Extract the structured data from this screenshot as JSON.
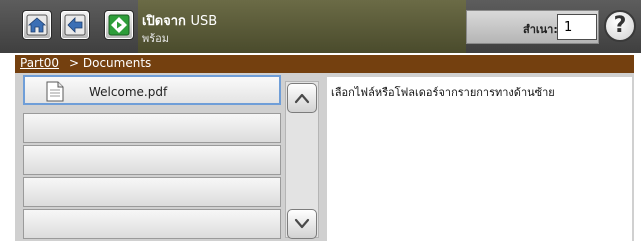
{
  "header": {
    "title": "เปิดจาก",
    "title_suffix": "USB",
    "status": "พร้อม",
    "copies_label": "สำเนา:",
    "copies_value": "1",
    "help_label": "?"
  },
  "breadcrumb": {
    "parent": "Part00",
    "current": "> Documents"
  },
  "files": [
    {
      "name": "Welcome.pdf",
      "icon": "document-icon",
      "selected": true
    },
    {
      "name": ""
    },
    {
      "name": ""
    },
    {
      "name": ""
    },
    {
      "name": ""
    }
  ],
  "info": {
    "text": "เลือกไฟล์หรือโฟลเดอร์จากรายการทางด้านซ้าย"
  },
  "colors": {
    "header_bg": "#4f4f4f",
    "title_panel_bg": "#5a5b3a",
    "breadcrumb_bg": "#74400f",
    "start_green": "#2e9d3a",
    "selection_border": "#6f9ed8"
  }
}
